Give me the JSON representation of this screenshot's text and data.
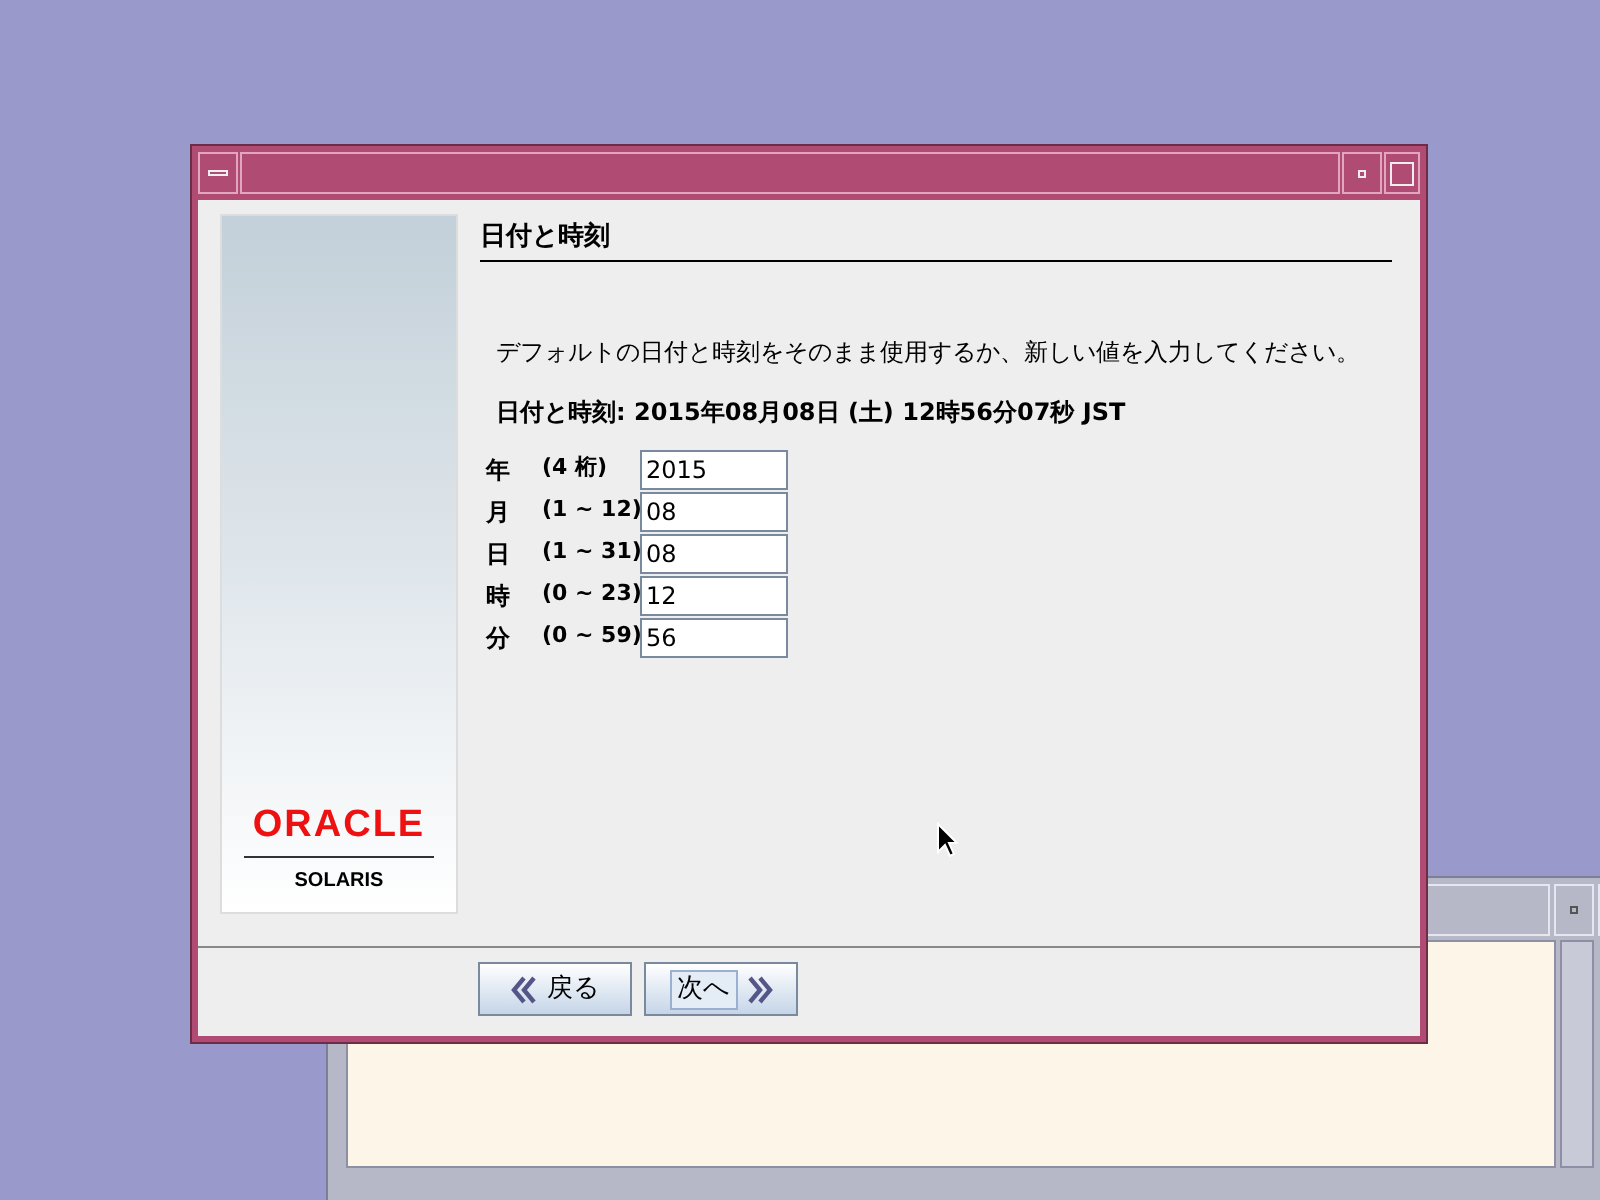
{
  "dialog": {
    "heading": "日付と時刻",
    "instruction": "デフォルトの日付と時刻をそのまま使用するか、新しい値を入力してください。",
    "current": "日付と時刻: 2015年08月08日 (土) 12時56分07秒 JST",
    "fields": [
      {
        "label": "年",
        "range": "(4 桁)",
        "value": "2015"
      },
      {
        "label": "月",
        "range": "(1 ~ 12)",
        "value": "08"
      },
      {
        "label": "日",
        "range": "(1 ~ 31)",
        "value": "08"
      },
      {
        "label": "時",
        "range": "(0 ~ 23)",
        "value": "12"
      },
      {
        "label": "分",
        "range": "(0 ~ 59)",
        "value": "56"
      }
    ],
    "logo": {
      "brand": "ORACLE",
      "product": "SOLARIS"
    },
    "buttons": [
      {
        "label": "戻る",
        "kind": "back",
        "focused": false
      },
      {
        "label": "次へ",
        "kind": "next",
        "focused": true
      }
    ]
  }
}
